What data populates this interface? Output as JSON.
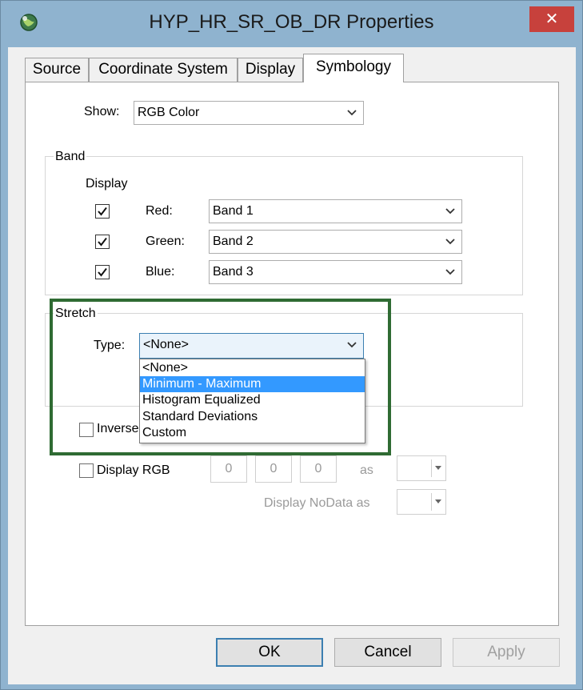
{
  "window": {
    "title": "HYP_HR_SR_OB_DR  Properties",
    "close_glyph": "✕",
    "app_icon": "globe-icon",
    "colors": {
      "titlebar": "#8fb3cf",
      "close": "#c7413c",
      "highlight": "#2f6b33",
      "selection": "#3399ff"
    }
  },
  "tabs": [
    {
      "label": "Source"
    },
    {
      "label": "Coordinate System"
    },
    {
      "label": "Display"
    },
    {
      "label": "Symbology",
      "active": true
    }
  ],
  "show": {
    "label": "Show:",
    "value": "RGB Color"
  },
  "band": {
    "group_label": "Band",
    "display_label": "Display",
    "rows": [
      {
        "label": "Red:",
        "value": "Band 1",
        "checked": true
      },
      {
        "label": "Green:",
        "value": "Band 2",
        "checked": true
      },
      {
        "label": "Blue:",
        "value": "Band 3",
        "checked": true
      }
    ]
  },
  "stretch": {
    "group_label": "Stretch",
    "type_label": "Type:",
    "type_value": "<None>",
    "options": [
      {
        "label": "<None>"
      },
      {
        "label": "Minimum - Maximum",
        "selected": true
      },
      {
        "label": "Histogram Equalized"
      },
      {
        "label": "Standard Deviations"
      },
      {
        "label": "Custom"
      }
    ]
  },
  "inverse": {
    "label": "Inverse",
    "checked": false
  },
  "display_rgb": {
    "label": "Display RGB",
    "checked": false,
    "values": [
      "0",
      "0",
      "0"
    ],
    "as_label": "as"
  },
  "nodata": {
    "label": "Display NoData as"
  },
  "buttons": {
    "ok": "OK",
    "cancel": "Cancel",
    "apply": "Apply"
  }
}
